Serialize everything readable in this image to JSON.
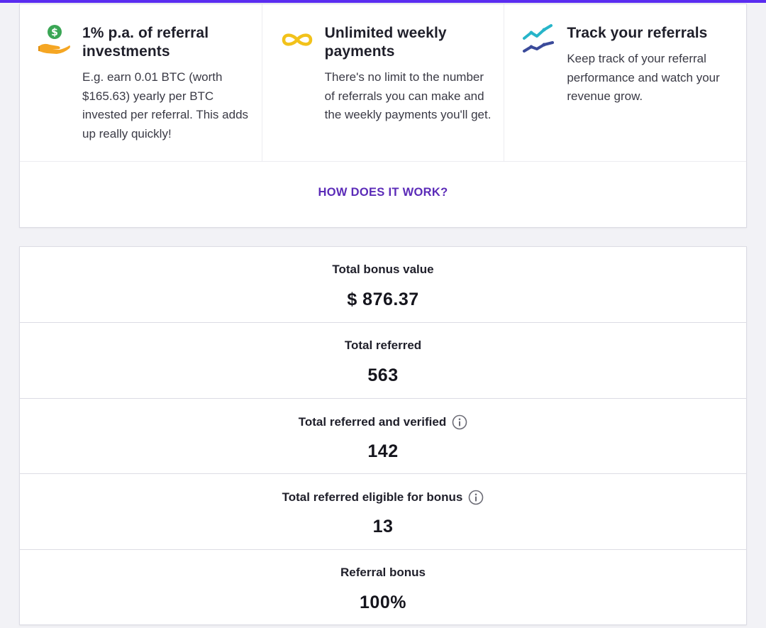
{
  "features": [
    {
      "icon": "money-hand-icon",
      "title": "1% p.a. of referral investments",
      "description": "E.g. earn 0.01 BTC (worth $165.63) yearly per BTC invested per referral. This adds up really quickly!"
    },
    {
      "icon": "infinity-icon",
      "title": "Unlimited weekly payments",
      "description": "There's no limit to the number of referrals you can make and the weekly payments you'll get."
    },
    {
      "icon": "trend-chart-icon",
      "title": "Track your referrals",
      "description": "Keep track of your referral performance and watch your revenue grow."
    }
  ],
  "how_link": "HOW DOES IT WORK?",
  "stats": [
    {
      "label": "Total bonus value",
      "value": "$ 876.37",
      "info": false
    },
    {
      "label": "Total referred",
      "value": "563",
      "info": false
    },
    {
      "label": "Total referred and verified",
      "value": "142",
      "info": true
    },
    {
      "label": "Total referred eligible for bonus",
      "value": "13",
      "info": true
    },
    {
      "label": "Referral bonus",
      "value": "100%",
      "info": false
    }
  ],
  "colors": {
    "accent_bar": "#5a2cf0",
    "link": "#5b2bb8",
    "dollar_green": "#3aa655",
    "hand_orange": "#f5a623",
    "infinity_yellow": "#f2c21b",
    "trend_teal": "#27b5c9",
    "trend_navy": "#3a4a9a"
  }
}
